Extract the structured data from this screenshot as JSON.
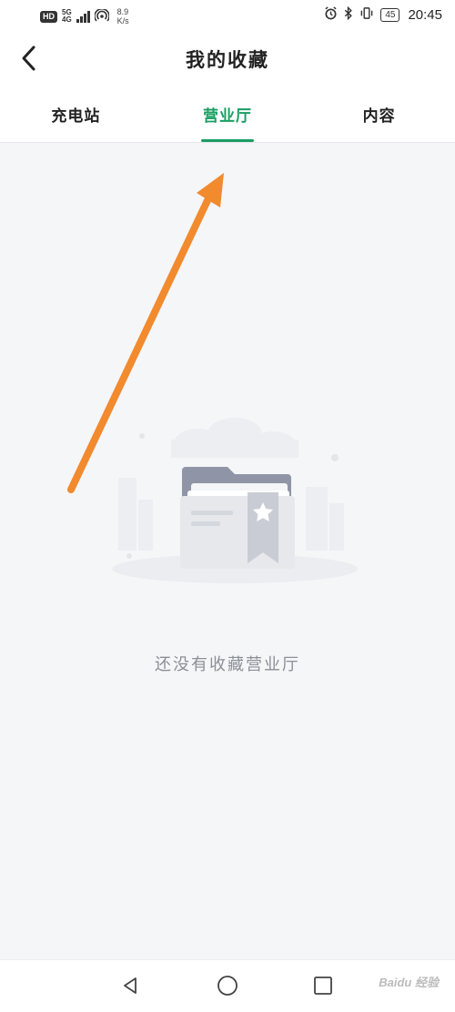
{
  "status_bar": {
    "hd": "HD",
    "network": "5G",
    "network_sub": "4G",
    "speed_value": "8.9",
    "speed_unit": "K/s",
    "battery": "45",
    "time": "20:45"
  },
  "header": {
    "title": "我的收藏",
    "back_icon": "chevron-left-icon"
  },
  "tabs": [
    {
      "label": "充电站",
      "active": false
    },
    {
      "label": "营业厅",
      "active": true
    },
    {
      "label": "内容",
      "active": false
    }
  ],
  "empty_state": {
    "message": "还没有收藏营业厅",
    "illustration": "empty-folder-star-illustration"
  },
  "annotation": {
    "arrow_color": "#f28a2e"
  },
  "nav_bar": {
    "back_icon": "triangle-back-icon",
    "home_icon": "circle-home-icon",
    "recents_icon": "square-recents-icon"
  },
  "watermark": "Baidu 经验",
  "colors": {
    "accent": "#1a9e63",
    "background": "#f5f6f8",
    "empty_text": "#8b8f96"
  }
}
